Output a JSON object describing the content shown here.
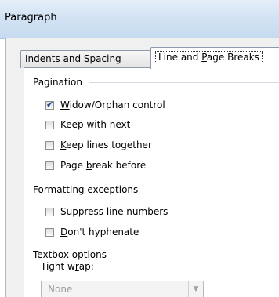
{
  "window": {
    "title": "Paragraph"
  },
  "tabs": [
    {
      "pre": "",
      "key": "I",
      "post": "ndents and Spacing"
    },
    {
      "pre": "Line and ",
      "key": "P",
      "post": "age Breaks"
    }
  ],
  "pagination": {
    "heading": "Pagination",
    "items": [
      {
        "pre": "",
        "key": "W",
        "post": "idow/Orphan control",
        "checked": true
      },
      {
        "pre": "Keep with ne",
        "key": "x",
        "post": "t",
        "checked": false
      },
      {
        "pre": "",
        "key": "K",
        "post": "eep lines together",
        "checked": false
      },
      {
        "pre": "Page ",
        "key": "b",
        "post": "reak before",
        "checked": false
      }
    ]
  },
  "formatting_exceptions": {
    "heading": "Formatting exceptions",
    "items": [
      {
        "pre": "",
        "key": "S",
        "post": "uppress line numbers",
        "checked": false
      },
      {
        "pre": "",
        "key": "D",
        "post": "on't hyphenate",
        "checked": false
      }
    ]
  },
  "textbox_options": {
    "heading": "Textbox options",
    "tight_wrap": {
      "pre": "Tight w",
      "key": "r",
      "post": "ap:"
    },
    "tight_wrap_value": "None"
  }
}
